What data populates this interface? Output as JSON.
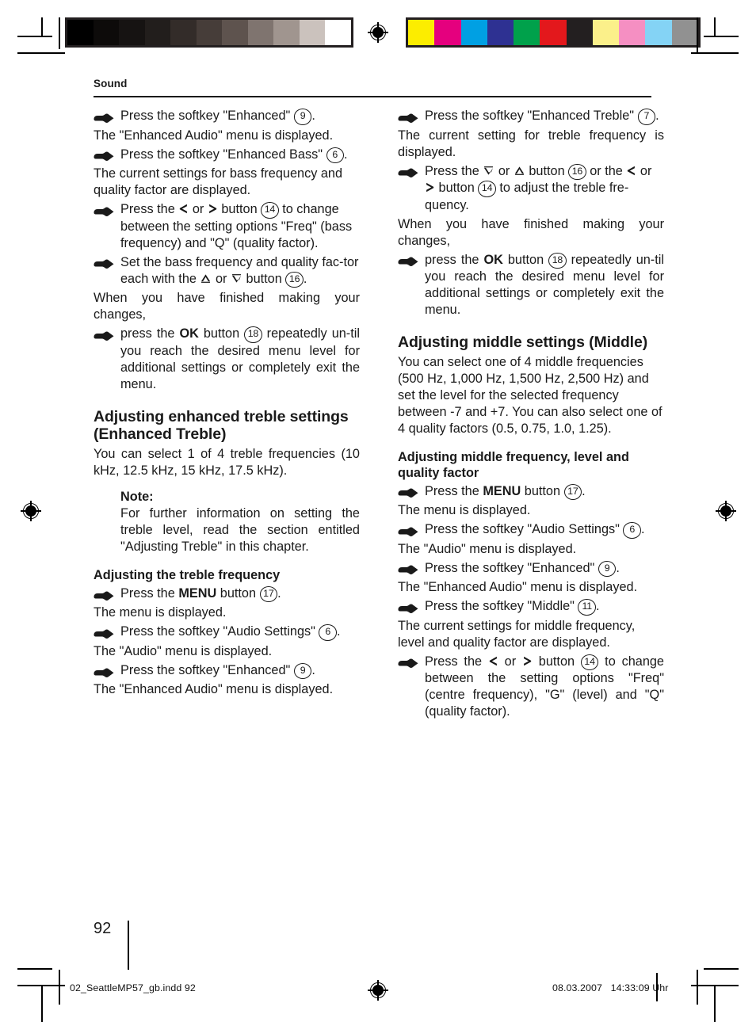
{
  "page": {
    "running_head": "Sound",
    "page_number": "92",
    "imprint_file": "02_SeattleMP57_gb.indd   92",
    "imprint_date": "08.03.2007",
    "imprint_time": "14:33:09 Uhr"
  },
  "prepress": {
    "gray_wedge": [
      "#000000",
      "#0d0b0a",
      "#161312",
      "#221e1c",
      "#332c29",
      "#463d39",
      "#5e534e",
      "#7f746f",
      "#a0958f",
      "#cbc2bd",
      "#ffffff"
    ],
    "color_wedge": [
      "#fced00",
      "#e5007e",
      "#00a0e3",
      "#2e3192",
      "#00a14b",
      "#e3181c",
      "#231f20",
      "#fbf08a",
      "#f58fc2",
      "#84d3f5",
      "#919191"
    ]
  },
  "left_column": {
    "blocks": [
      {
        "type": "step",
        "justify": false,
        "runs": [
          {
            "t": "text",
            "v": "Press the softkey \"Enhanced\" "
          },
          {
            "t": "key",
            "v": "9"
          },
          {
            "t": "text",
            "v": "."
          }
        ]
      },
      {
        "type": "para",
        "justify": false,
        "runs": [
          {
            "t": "text",
            "v": "The \"Enhanced Audio\" menu is displayed."
          }
        ]
      },
      {
        "type": "step",
        "justify": true,
        "runs": [
          {
            "t": "text",
            "v": "Press the softkey \"Enhanced Bass\" "
          },
          {
            "t": "key",
            "v": "6"
          },
          {
            "t": "text",
            "v": "."
          }
        ]
      },
      {
        "type": "para",
        "justify": false,
        "runs": [
          {
            "t": "text",
            "v": "The current settings for bass frequency and quality factor are displayed."
          }
        ]
      },
      {
        "type": "step",
        "justify": false,
        "runs": [
          {
            "t": "text",
            "v": "Press the "
          },
          {
            "t": "arrow",
            "v": "left"
          },
          {
            "t": "text",
            "v": " or "
          },
          {
            "t": "arrow",
            "v": "right"
          },
          {
            "t": "text",
            "v": " button "
          },
          {
            "t": "key",
            "v": "14"
          },
          {
            "t": "text",
            "v": " to change between the setting options \"Freq\" (bass frequency) and \"Q\" (quality factor)."
          }
        ]
      },
      {
        "type": "step",
        "justify": false,
        "runs": [
          {
            "t": "text",
            "v": "Set the bass frequency and quality fac-tor each with the "
          },
          {
            "t": "arrow",
            "v": "up"
          },
          {
            "t": "text",
            "v": " or "
          },
          {
            "t": "arrow",
            "v": "down"
          },
          {
            "t": "text",
            "v": " button "
          },
          {
            "t": "key",
            "v": "16"
          },
          {
            "t": "text",
            "v": "."
          }
        ]
      },
      {
        "type": "para",
        "justify": true,
        "runs": [
          {
            "t": "text",
            "v": "When you have finished making your changes,"
          }
        ]
      },
      {
        "type": "step",
        "justify": true,
        "runs": [
          {
            "t": "text",
            "v": "press the "
          },
          {
            "t": "bold",
            "v": "OK"
          },
          {
            "t": "text",
            "v": " button "
          },
          {
            "t": "key",
            "v": "18"
          },
          {
            "t": "text",
            "v": " repeatedly un-til you reach the desired menu level for additional settings or completely exit the menu."
          }
        ]
      },
      {
        "type": "h2",
        "runs": [
          {
            "t": "text",
            "v": "Adjusting enhanced treble settings (Enhanced Treble)"
          }
        ]
      },
      {
        "type": "para",
        "justify": true,
        "runs": [
          {
            "t": "text",
            "v": "You can select 1 of 4 treble frequencies (10 kHz, 12.5 kHz, 15 kHz, 17.5 kHz)."
          }
        ]
      },
      {
        "type": "note",
        "title": "Note:",
        "body": "For further information on setting the treble level, read the section entitled \"Adjusting Treble\" in this chapter."
      },
      {
        "type": "h3",
        "runs": [
          {
            "t": "text",
            "v": "Adjusting the treble frequency"
          }
        ]
      },
      {
        "type": "step",
        "justify": false,
        "runs": [
          {
            "t": "text",
            "v": "Press the "
          },
          {
            "t": "bold",
            "v": "MENU"
          },
          {
            "t": "text",
            "v": " button "
          },
          {
            "t": "key",
            "v": "17"
          },
          {
            "t": "text",
            "v": "."
          }
        ]
      },
      {
        "type": "para",
        "justify": false,
        "runs": [
          {
            "t": "text",
            "v": "The menu is displayed."
          }
        ]
      },
      {
        "type": "step",
        "justify": false,
        "runs": [
          {
            "t": "text",
            "v": "Press the softkey \"Audio Settings\" "
          },
          {
            "t": "key",
            "v": "6"
          },
          {
            "t": "text",
            "v": "."
          }
        ]
      },
      {
        "type": "para",
        "justify": false,
        "runs": [
          {
            "t": "text",
            "v": "The \"Audio\" menu is displayed."
          }
        ]
      },
      {
        "type": "step",
        "justify": false,
        "runs": [
          {
            "t": "text",
            "v": "Press the softkey \"Enhanced\" "
          },
          {
            "t": "key",
            "v": "9"
          },
          {
            "t": "text",
            "v": "."
          }
        ]
      },
      {
        "type": "para",
        "justify": false,
        "runs": [
          {
            "t": "text",
            "v": "The \"Enhanced Audio\" menu is displayed."
          }
        ]
      }
    ]
  },
  "right_column": {
    "blocks": [
      {
        "type": "step",
        "justify": true,
        "runs": [
          {
            "t": "text",
            "v": "Press the softkey \"Enhanced Treble\" "
          },
          {
            "t": "key",
            "v": "7"
          },
          {
            "t": "text",
            "v": "."
          }
        ]
      },
      {
        "type": "para",
        "justify": true,
        "runs": [
          {
            "t": "text",
            "v": "The current setting for treble frequency is displayed."
          }
        ]
      },
      {
        "type": "step",
        "justify": false,
        "runs": [
          {
            "t": "text",
            "v": "Press the "
          },
          {
            "t": "arrow",
            "v": "down"
          },
          {
            "t": "text",
            "v": " or "
          },
          {
            "t": "arrow",
            "v": "up"
          },
          {
            "t": "text",
            "v": " button "
          },
          {
            "t": "key",
            "v": "16"
          },
          {
            "t": "text",
            "v": " or the "
          },
          {
            "t": "arrow",
            "v": "left"
          },
          {
            "t": "text",
            "v": " or "
          },
          {
            "t": "arrow",
            "v": "right"
          },
          {
            "t": "text",
            "v": " button "
          },
          {
            "t": "key",
            "v": "14"
          },
          {
            "t": "text",
            "v": " to adjust the treble fre-quency."
          }
        ]
      },
      {
        "type": "para",
        "justify": true,
        "runs": [
          {
            "t": "text",
            "v": "When you have finished making your changes,"
          }
        ]
      },
      {
        "type": "step",
        "justify": true,
        "runs": [
          {
            "t": "text",
            "v": "press the "
          },
          {
            "t": "bold",
            "v": "OK"
          },
          {
            "t": "text",
            "v": " button "
          },
          {
            "t": "key",
            "v": "18"
          },
          {
            "t": "text",
            "v": " repeatedly un-til you reach the desired menu level for additional settings or completely exit the menu."
          }
        ]
      },
      {
        "type": "h2",
        "runs": [
          {
            "t": "text",
            "v": "Adjusting middle settings (Middle)"
          }
        ]
      },
      {
        "type": "para",
        "justify": false,
        "runs": [
          {
            "t": "text",
            "v": "You can select one of 4 middle frequencies (500 Hz,  1,000 Hz,  1,500 Hz,  2,500 Hz) and set the level for the selected frequency between -7 and +7. You can also select one of 4 quality factors (0.5, 0.75, 1.0, 1.25)."
          }
        ]
      },
      {
        "type": "h3",
        "runs": [
          {
            "t": "text",
            "v": "Adjusting middle frequency, level and quality factor"
          }
        ]
      },
      {
        "type": "step",
        "justify": false,
        "runs": [
          {
            "t": "text",
            "v": "Press the "
          },
          {
            "t": "bold",
            "v": "MENU"
          },
          {
            "t": "text",
            "v": " button "
          },
          {
            "t": "key",
            "v": "17"
          },
          {
            "t": "text",
            "v": "."
          }
        ]
      },
      {
        "type": "para",
        "justify": false,
        "runs": [
          {
            "t": "text",
            "v": "The menu is displayed."
          }
        ]
      },
      {
        "type": "step",
        "justify": false,
        "runs": [
          {
            "t": "text",
            "v": "Press the softkey \"Audio Settings\" "
          },
          {
            "t": "key",
            "v": "6"
          },
          {
            "t": "text",
            "v": "."
          }
        ]
      },
      {
        "type": "para",
        "justify": false,
        "runs": [
          {
            "t": "text",
            "v": "The \"Audio\" menu is displayed."
          }
        ]
      },
      {
        "type": "step",
        "justify": false,
        "runs": [
          {
            "t": "text",
            "v": "Press the softkey \"Enhanced\" "
          },
          {
            "t": "key",
            "v": "9"
          },
          {
            "t": "text",
            "v": "."
          }
        ]
      },
      {
        "type": "para",
        "justify": false,
        "runs": [
          {
            "t": "text",
            "v": "The \"Enhanced Audio\" menu is displayed."
          }
        ]
      },
      {
        "type": "step",
        "justify": false,
        "runs": [
          {
            "t": "text",
            "v": "Press the softkey \"Middle\" "
          },
          {
            "t": "key",
            "v": "11"
          },
          {
            "t": "text",
            "v": "."
          }
        ]
      },
      {
        "type": "para",
        "justify": false,
        "runs": [
          {
            "t": "text",
            "v": "The current settings for middle frequency, level and quality factor are displayed."
          }
        ]
      },
      {
        "type": "step",
        "justify": true,
        "runs": [
          {
            "t": "text",
            "v": "Press the "
          },
          {
            "t": "arrow",
            "v": "left"
          },
          {
            "t": "text",
            "v": " or "
          },
          {
            "t": "arrow",
            "v": "right"
          },
          {
            "t": "text",
            "v": " button "
          },
          {
            "t": "key",
            "v": "14"
          },
          {
            "t": "text",
            "v": " to change between the setting options \"Freq\" (centre frequency), \"G\" (level) and \"Q\" (quality factor)."
          }
        ]
      }
    ]
  }
}
